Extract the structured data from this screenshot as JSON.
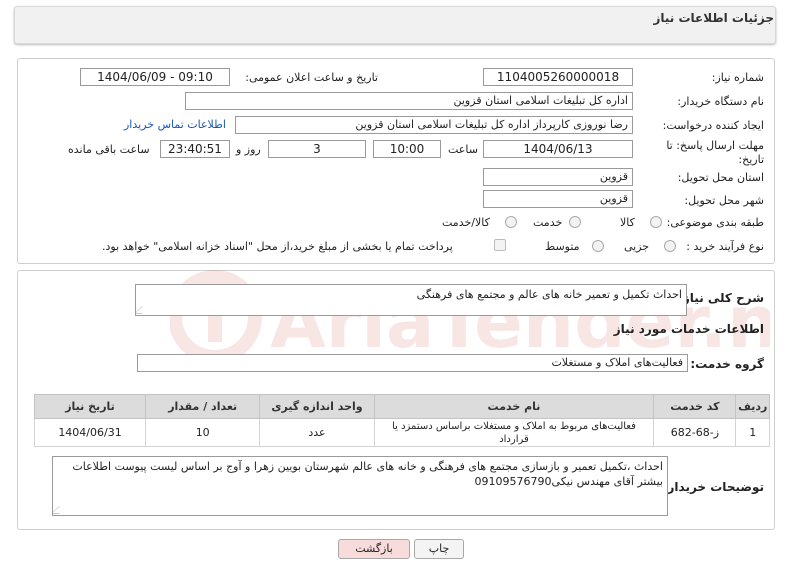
{
  "header": {
    "title": "جزئیات اطلاعات نیاز"
  },
  "form": {
    "need_number_label": "شماره نیاز:",
    "need_number": "1104005260000018",
    "announce_label": "تاریخ و ساعت اعلان عمومی:",
    "announce_value": "1404/06/09 - 09:10",
    "buyer_org_label": "نام دستگاه خریدار:",
    "buyer_org": "اداره کل تبلیغات اسلامی استان قزوین",
    "requester_label": "ایجاد کننده درخواست:",
    "requester": "رضا نوروزی کارپرداز اداره کل تبلیغات اسلامی استان قزوین",
    "contact_link": "اطلاعات تماس خریدار",
    "deadline_label": "مهلت ارسال پاسخ: تا تاریخ:",
    "deadline_date": "1404/06/13",
    "time_label": "ساعت",
    "deadline_time": "10:00",
    "days_value": "3",
    "days_label": "روز و",
    "remaining_time": "23:40:51",
    "remaining_label": "ساعت باقی مانده",
    "province_label": "استان محل تحویل:",
    "province": "قزوین",
    "city_label": "شهر محل تحویل:",
    "city": "قزوین",
    "category_label": "طبقه بندی موضوعی:",
    "category_options": [
      "کالا",
      "خدمت",
      "کالا/خدمت"
    ],
    "process_label": "نوع فرآیند خرید :",
    "process_options": [
      "جزیی",
      "متوسط"
    ],
    "payment_note": "پرداخت تمام یا بخشی از مبلغ خرید،از محل \"اسناد خزانه اسلامی\" خواهد بود."
  },
  "summary": {
    "label": "شرح کلی نیاز:",
    "text": "احداث تکمیل و تعمیر خانه های عالم و مجتمع های فرهنگی"
  },
  "services": {
    "section_title": "اطلاعات خدمات مورد نیاز",
    "group_label": "گروه خدمت:",
    "group_value": "فعالیت‌های  املاک و مستغلات",
    "columns": [
      "ردیف",
      "کد خدمت",
      "نام خدمت",
      "واحد اندازه گیری",
      "تعداد / مقدار",
      "تاریخ نیاز"
    ],
    "rows": [
      {
        "row": "1",
        "code": "ز-68-682",
        "name": "فعالیت‌های مربوط به املاک و مستغلات براساس دستمزد یا قرارداد",
        "unit": "عدد",
        "qty": "10",
        "date": "1404/06/31"
      }
    ]
  },
  "buyer_notes": {
    "label": "توضیحات خریدار:",
    "text": "احداث ،تکمیل تعمیر و بازسازی مجتمع های فرهنگی و خانه های عالم شهرستان بویین زهرا و آوج بر اساس لیست پیوست اطلاعات بیشتر آقای مهندس نیکی09109576790"
  },
  "buttons": {
    "print": "چاپ",
    "back": "بازگشت"
  },
  "watermark_text": "AriaTender.neT",
  "colors": {
    "link": "#1a56b5",
    "back_button": "#f8dcdc",
    "watermark": "#c0392b"
  }
}
